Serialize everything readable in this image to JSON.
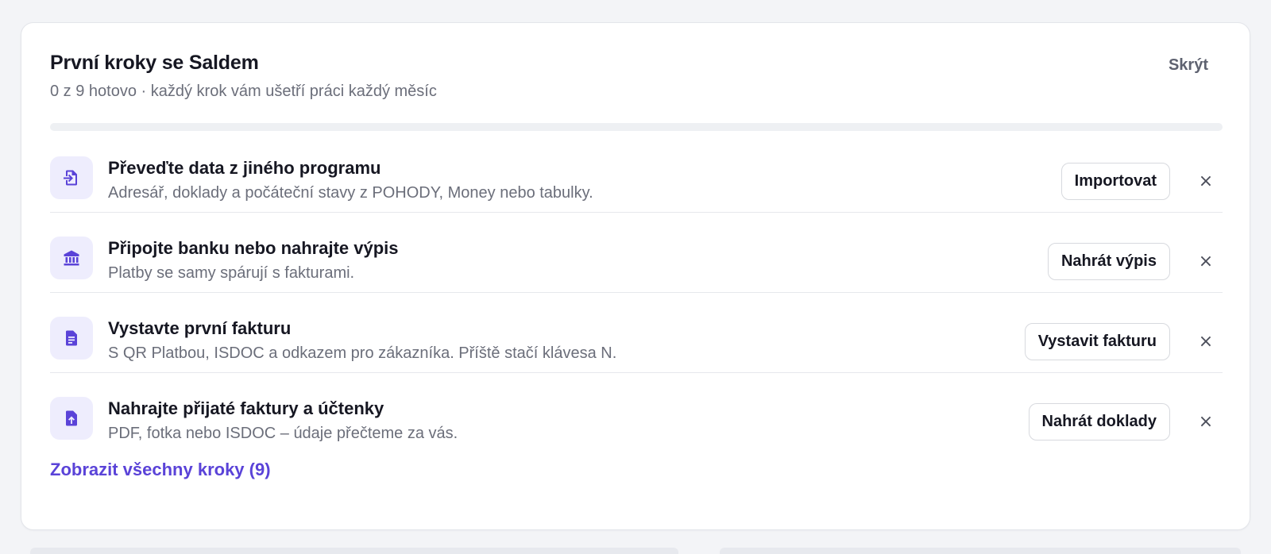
{
  "card": {
    "title": "První kroky se Saldem",
    "subtitle": "0 z 9 hotovo · každý krok vám ušetří práci každý měsíc",
    "hide_label": "Skrýt",
    "progress": {
      "done": 0,
      "total": 9,
      "fraction": 0.0
    }
  },
  "steps": [
    {
      "title": "Převeďte data z jiného programu",
      "description": "Adresář, doklady a počáteční stavy z POHODY, Money nebo tabulky.",
      "action": "Importovat",
      "icon": "import-icon"
    },
    {
      "title": "Připojte banku nebo nahrajte výpis",
      "description": "Platby se samy spárují s fakturami.",
      "action": "Nahrát výpis",
      "icon": "bank-icon"
    },
    {
      "title": "Vystavte první fakturu",
      "description": "S QR Platbou, ISDOC a odkazem pro zákazníka. Příště stačí klávesa N.",
      "action": "Vystavit fakturu",
      "icon": "invoice-icon"
    },
    {
      "title": "Nahrajte přijaté faktury a účtenky",
      "description": "PDF, fotka nebo ISDOC – údaje přečteme za vás.",
      "action": "Nahrát doklady",
      "icon": "upload-file-icon"
    }
  ],
  "dismiss_glyph": "×",
  "show_all_label": "Zobrazit všechny kroky (9)",
  "colors": {
    "accent": "#5a43d8",
    "icon_bg": "#eeedfd",
    "text_primary": "#161722",
    "text_secondary": "#6b6e7a",
    "page_bg": "#f3f4f7"
  }
}
